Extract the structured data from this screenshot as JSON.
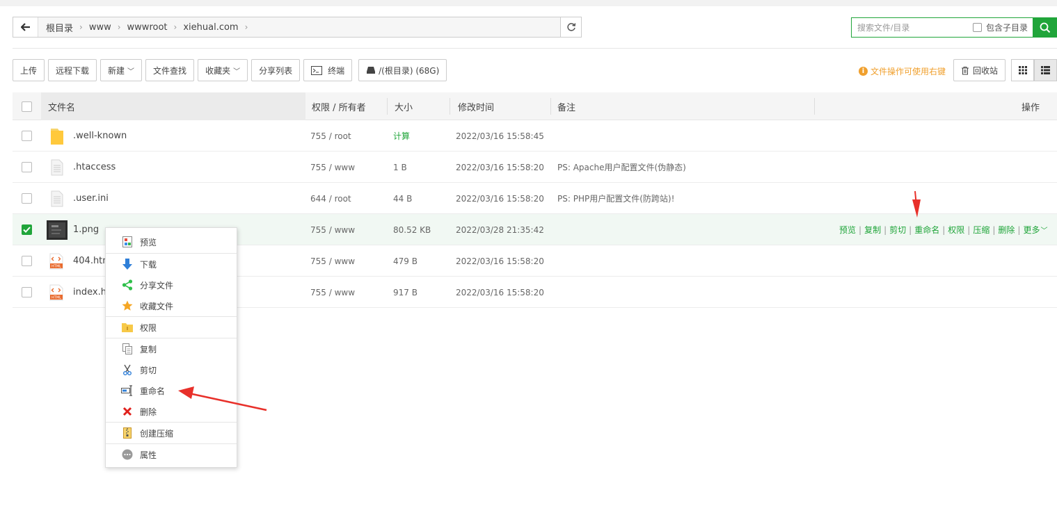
{
  "pathbar": {
    "crumbs": [
      "根目录",
      "www",
      "wwwroot",
      "xiehual.com"
    ]
  },
  "search": {
    "placeholder": "搜索文件/目录",
    "include_sub_label": "包含子目录"
  },
  "toolbar": {
    "upload": "上传",
    "remote_download": "远程下载",
    "new": "新建",
    "file_find": "文件查找",
    "favorites": "收藏夹",
    "share_list": "分享列表",
    "terminal": "终端",
    "disk": "/(根目录) (68G)",
    "tip": "文件操作可使用右键",
    "recycle": "回收站"
  },
  "table": {
    "headers": {
      "name": "文件名",
      "perm": "权限 / 所有者",
      "size": "大小",
      "mtime": "修改时间",
      "note": "备注",
      "ops": "操作"
    },
    "rows": [
      {
        "name": ".well-known",
        "perm": "755 / root",
        "size": "计算",
        "mtime": "2022/03/16 15:58:45",
        "note": "",
        "type": "folder"
      },
      {
        "name": ".htaccess",
        "perm": "755 / www",
        "size": "1 B",
        "mtime": "2022/03/16 15:58:20",
        "note": "PS: Apache用户配置文件(伪静态)",
        "type": "file"
      },
      {
        "name": ".user.ini",
        "perm": "644 / root",
        "size": "44 B",
        "mtime": "2022/03/16 15:58:20",
        "note": "PS: PHP用户配置文件(防跨站)!",
        "type": "file"
      },
      {
        "name": "1.png",
        "perm": "755 / www",
        "size": "80.52 KB",
        "mtime": "2022/03/28 21:35:42",
        "note": "",
        "type": "image",
        "selected": true
      },
      {
        "name": "404.htm",
        "perm": "755 / www",
        "size": "479 B",
        "mtime": "2022/03/16 15:58:20",
        "note": "",
        "type": "html"
      },
      {
        "name": "index.ht",
        "perm": "755 / www",
        "size": "917 B",
        "mtime": "2022/03/16 15:58:20",
        "note": "",
        "type": "html"
      }
    ],
    "row_ops": [
      "预览",
      "复制",
      "剪切",
      "重命名",
      "权限",
      "压缩",
      "删除",
      "更多"
    ]
  },
  "context_menu": {
    "items": [
      "预览",
      "下载",
      "分享文件",
      "收藏文件",
      "权限",
      "复制",
      "剪切",
      "重命名",
      "删除",
      "创建压缩",
      "属性"
    ]
  },
  "colors": {
    "accent": "#20a53a",
    "tip": "#f0a02e",
    "annotation_arrow": "#e8302a"
  }
}
